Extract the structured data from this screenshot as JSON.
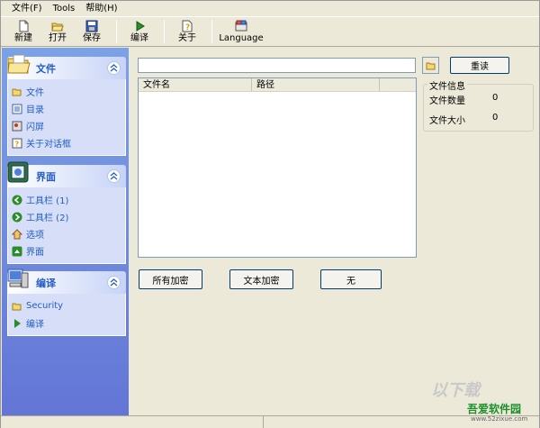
{
  "menu": [
    "文件(F)",
    "Tools",
    "帮助(H)"
  ],
  "toolbar": {
    "buttons": [
      {
        "label": "新建",
        "icon": "new-file-icon"
      },
      {
        "label": "打开",
        "icon": "open-folder-icon"
      },
      {
        "label": "保存",
        "icon": "save-disk-icon"
      },
      {
        "label": "编译",
        "icon": "play-compile-icon"
      },
      {
        "label": "关于",
        "icon": "about-question-icon"
      },
      {
        "label": "Language",
        "icon": "language-icon"
      }
    ]
  },
  "sidebar": {
    "panels": [
      {
        "title": "文件",
        "icon": "folder-icon",
        "items": [
          {
            "label": "文件",
            "icon": "folder-open-icon"
          },
          {
            "label": "目录",
            "icon": "directory-icon"
          },
          {
            "label": "闪屏",
            "icon": "splash-image-icon"
          },
          {
            "label": "关于对话框",
            "icon": "question-icon"
          }
        ]
      },
      {
        "title": "界面",
        "icon": "interface-icon",
        "items": [
          {
            "label": "工具栏 (1)",
            "icon": "arrow-left-icon"
          },
          {
            "label": "工具栏 (2)",
            "icon": "arrow-right-icon"
          },
          {
            "label": "选项",
            "icon": "home-icon"
          },
          {
            "label": "界面",
            "icon": "arrow-up-icon"
          }
        ]
      },
      {
        "title": "编译",
        "icon": "computer-icon",
        "items": [
          {
            "label": "Security",
            "icon": "folder-open-icon"
          },
          {
            "label": "编译",
            "icon": "play-icon"
          }
        ]
      }
    ]
  },
  "main": {
    "path_value": "",
    "reload_label": "重读",
    "list_columns": [
      "文件名",
      "路径"
    ],
    "fileinfo": {
      "title": "文件信息",
      "count_label": "文件数量",
      "count_value": "0",
      "size_label": "文件大小",
      "size_value": "0"
    },
    "buttons": {
      "encrypt_all": "所有加密",
      "encrypt_text": "文本加密",
      "none": "无"
    }
  },
  "watermark": {
    "logo": "以下载",
    "title": "吾爱软件园",
    "url": "www.52zixue.com"
  },
  "colors": {
    "sidebar_gradient_top": "#7ba2e7",
    "sidebar_gradient_bottom": "#6375d6",
    "panel_title": "#215dc6",
    "panel_body": "#d6dff7",
    "window_bg": "#ece9d8"
  }
}
